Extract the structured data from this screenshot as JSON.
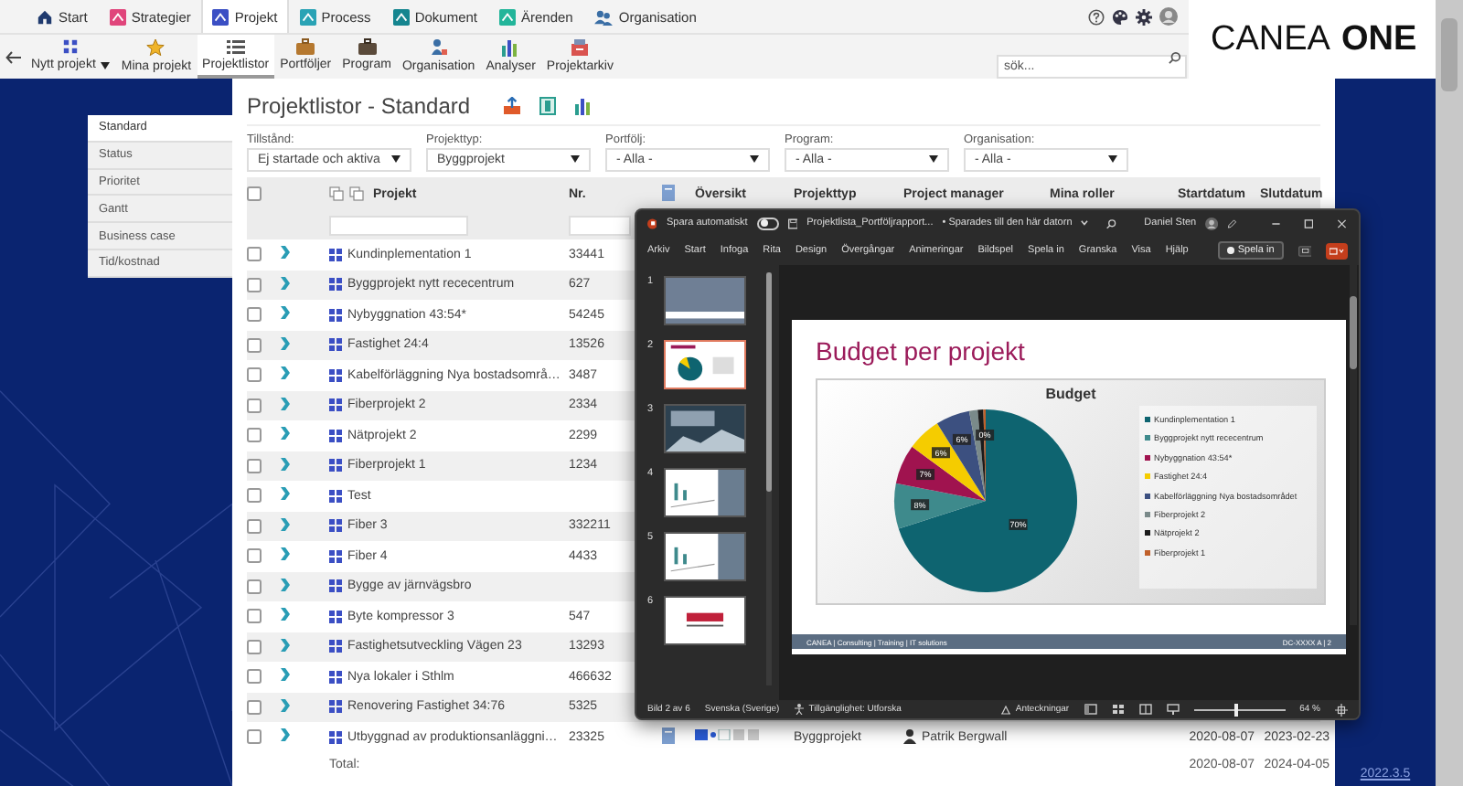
{
  "nav": {
    "tabs": [
      {
        "label": "Start",
        "kind": "house",
        "color": "#1f3a6e",
        "selected": false
      },
      {
        "label": "Strategier",
        "kind": "tile",
        "color": "#e0457b",
        "selected": false
      },
      {
        "label": "Projekt",
        "kind": "tile",
        "color": "#3b4fc4",
        "selected": true
      },
      {
        "label": "Process",
        "kind": "tile",
        "color": "#2aa3b5",
        "selected": false
      },
      {
        "label": "Dokument",
        "kind": "tile",
        "color": "#15858f",
        "selected": false
      },
      {
        "label": "Ärenden",
        "kind": "tile",
        "color": "#22b59a",
        "selected": false
      },
      {
        "label": "Organisation",
        "kind": "people",
        "color": "#3a6ea5",
        "selected": false
      }
    ],
    "toolbar": [
      {
        "label": "Nytt projekt",
        "kind": "grid",
        "dropdown": true,
        "selected": false
      },
      {
        "label": "Mina projekt",
        "kind": "star",
        "dropdown": false,
        "selected": false
      },
      {
        "label": "Projektlistor",
        "kind": "list",
        "dropdown": false,
        "selected": true
      },
      {
        "label": "Portföljer",
        "kind": "briefcase",
        "dropdown": false,
        "selected": false
      },
      {
        "label": "Program",
        "kind": "bag",
        "dropdown": false,
        "selected": false
      },
      {
        "label": "Organisation",
        "kind": "org",
        "dropdown": false,
        "selected": false
      },
      {
        "label": "Analyser",
        "kind": "chart",
        "dropdown": false,
        "selected": false
      },
      {
        "label": "Projektarkiv",
        "kind": "archive",
        "dropdown": false,
        "selected": false
      }
    ],
    "search": {
      "placeholder": "sök..."
    },
    "logo": "CANEA **ONE**"
  },
  "list_views": [
    {
      "label": "Standard",
      "selected": true
    },
    {
      "label": "Status",
      "selected": false
    },
    {
      "label": "Prioritet",
      "selected": false
    },
    {
      "label": "Gantt",
      "selected": false
    },
    {
      "label": "Business case",
      "selected": false
    },
    {
      "label": "Tid/kostnad",
      "selected": false
    }
  ],
  "page": {
    "title": "Projektlistor - Standard"
  },
  "filters": [
    {
      "label": "Tillstånd:",
      "value": "Ej startade och aktiva"
    },
    {
      "label": "Projekttyp:",
      "value": "Byggprojekt"
    },
    {
      "label": "Portfölj:",
      "value": "- Alla -"
    },
    {
      "label": "Program:",
      "value": "- Alla -"
    },
    {
      "label": "Organisation:",
      "value": "- Alla -"
    }
  ],
  "table": {
    "header_checked": false,
    "columns": [
      "Projekt",
      "Nr.",
      "Översikt",
      "Projekttyp",
      "Project manager",
      "Mina roller",
      "Startdatum",
      "Slutdatum"
    ],
    "rows": [
      {
        "checked": false,
        "name": "Kundinplementation 1",
        "nr": "33441"
      },
      {
        "checked": false,
        "name": "Byggprojekt nytt rececentrum",
        "nr": "627"
      },
      {
        "checked": false,
        "name": "Nybyggnation 43:54*",
        "nr": "54245"
      },
      {
        "checked": false,
        "name": "Fastighet 24:4",
        "nr": "13526"
      },
      {
        "checked": false,
        "name": "Kabelförläggning Nya bostadsområ…",
        "nr": "3487"
      },
      {
        "checked": false,
        "name": "Fiberprojekt 2",
        "nr": "2334"
      },
      {
        "checked": false,
        "name": "Nätprojekt 2",
        "nr": "2299"
      },
      {
        "checked": false,
        "name": "Fiberprojekt 1",
        "nr": "1234"
      },
      {
        "checked": false,
        "name": "Test"
      },
      {
        "checked": false,
        "name": "Fiber 3",
        "nr": "332211"
      },
      {
        "checked": false,
        "name": "Fiber 4",
        "nr": "4433"
      },
      {
        "checked": false,
        "name": "Bygge av järnvägsbro"
      },
      {
        "checked": false,
        "name": "Byte kompressor 3",
        "nr": "547"
      },
      {
        "checked": false,
        "name": "Fastighetsutveckling Vägen 23",
        "nr": "13293"
      },
      {
        "checked": false,
        "name": "Nya lokaler i Sthlm",
        "nr": "466632"
      },
      {
        "checked": false,
        "name": "Renovering Fastighet 34:76",
        "nr": "5325"
      },
      {
        "checked": false,
        "name": "Utbyggnad av produktionsanläggni…",
        "nr": "23325",
        "projekttyp": "Byggprojekt",
        "project_manager": "Patrik Bergwall",
        "startdatum": "2020-08-07",
        "slutdatum": "2023-02-23"
      }
    ],
    "total": {
      "label": "Total:",
      "startdatum": "2020-08-07",
      "slutdatum": "2024-04-05"
    }
  },
  "version": "2022.3.5",
  "powerpoint": {
    "autosave": {
      "label": "Spara automatiskt",
      "on": false
    },
    "filename": "Projektlista_Portföljrapport...",
    "save_status": "• Sparades till den här datorn",
    "user": "Daniel Sten",
    "ribbon_tabs": [
      "Arkiv",
      "Start",
      "Infoga",
      "Rita",
      "Design",
      "Övergångar",
      "Animeringar",
      "Bildspel",
      "Spela in",
      "Granska",
      "Visa",
      "Hjälp"
    ],
    "record_button": "Spela in",
    "slides": [
      {
        "number": "1",
        "kind": "title",
        "selected": false
      },
      {
        "number": "2",
        "kind": "pie",
        "selected": true
      },
      {
        "number": "3",
        "kind": "photo",
        "selected": false
      },
      {
        "number": "4",
        "kind": "chart",
        "selected": false
      },
      {
        "number": "5",
        "kind": "chart",
        "selected": false
      },
      {
        "number": "6",
        "kind": "logo",
        "selected": false
      }
    ],
    "slide": {
      "title": "Budget per projekt",
      "chart_data": {
        "type": "pie",
        "title": "Budget",
        "categories": [
          "Kundinplementation 1",
          "Byggprojekt nytt rececentrum",
          "Nybyggnation 43:54*",
          "Fastighet 24:4",
          "Kabelförläggning Nya bostadsområdet",
          "Fiberprojekt 2",
          "Nätprojekt 2",
          "Fiberprojekt 1"
        ],
        "values": [
          70,
          8,
          7,
          6,
          6,
          1.5,
          1,
          0.4
        ],
        "colors": [
          "#0e6470",
          "#3e8a8c",
          "#a0134f",
          "#f5cc00",
          "#3c5080",
          "#7a8a8a",
          "#1a1a1a",
          "#c0602a"
        ],
        "value_labels": [
          "70%",
          "8%",
          "7%",
          "6%",
          "6%",
          null,
          null,
          "0%"
        ]
      },
      "footer_left": "CANEA | Consulting | Training | IT solutions",
      "footer_right": "DC-XXXX A | 2"
    },
    "status": {
      "slide": "Bild 2 av 6",
      "language": "Svenska (Sverige)",
      "accessibility": "Tillgänglighet: Utforska",
      "notes": "Anteckningar",
      "zoom": "64 %",
      "level": 0.45
    }
  }
}
